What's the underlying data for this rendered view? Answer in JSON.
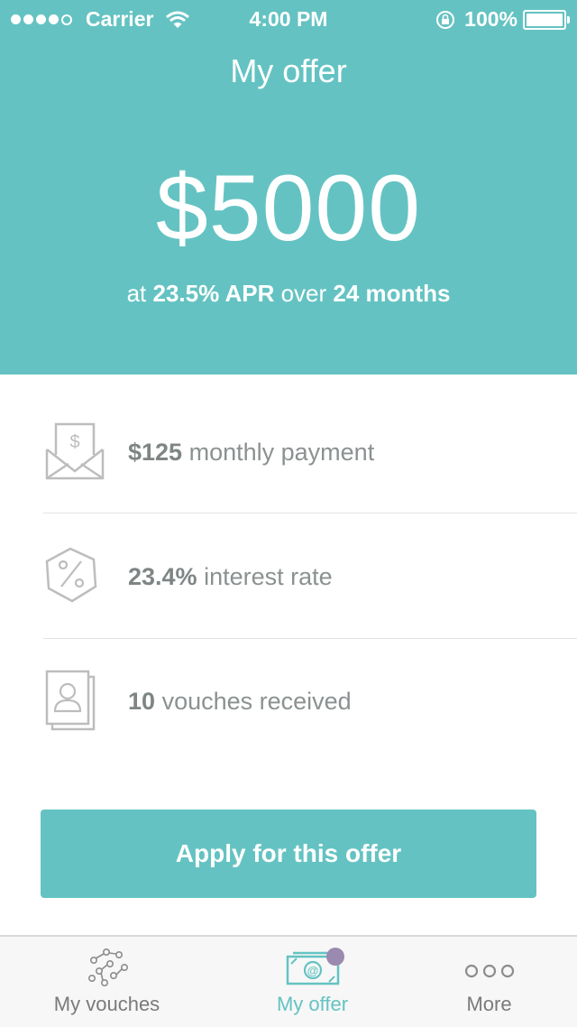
{
  "status": {
    "carrier": "Carrier",
    "time": "4:00 PM",
    "battery": "100%"
  },
  "header": {
    "title": "My offer",
    "amount": "$5000",
    "terms": {
      "prefix": "at",
      "apr": "23.5% APR",
      "mid": "over",
      "duration": "24 months"
    }
  },
  "details": [
    {
      "icon": "envelope-dollar-icon",
      "value": "$125",
      "label": "monthly payment"
    },
    {
      "icon": "percent-hexagon-icon",
      "value": "23.4%",
      "label": "interest rate"
    },
    {
      "icon": "vouches-cards-icon",
      "value": "10",
      "label": "vouches received"
    }
  ],
  "apply_button": "Apply for this offer",
  "tabs": [
    {
      "label": "My vouches",
      "icon": "network-dots-icon",
      "active": false
    },
    {
      "label": "My offer",
      "icon": "banknote-icon",
      "active": true
    },
    {
      "label": "More",
      "icon": "more-dots-icon",
      "active": false
    }
  ],
  "colors": {
    "accent": "#64c3c2",
    "badge": "#9a8aaf",
    "text_gray": "#8b9191"
  }
}
